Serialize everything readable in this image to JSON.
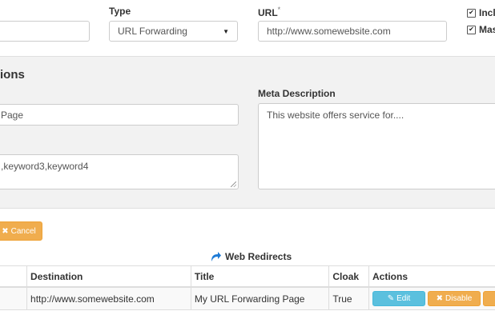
{
  "top_form": {
    "type_label": "Type",
    "type_value": "URL Forwarding",
    "url_label": "URL",
    "url_required_mark": "*",
    "url_value": "http://www.somewebsite.com",
    "include_label": "Inclu",
    "mask_label": "Mas"
  },
  "options": {
    "heading": "ions",
    "title_value": "Page",
    "keywords_value": ",keyword3,keyword4",
    "meta_label": "Meta Description",
    "meta_value": "This website offers service for...."
  },
  "cancel_label": "Cancel",
  "table": {
    "title": "Web Redirects",
    "headers": [
      "Destination",
      "Title",
      "Cloak",
      "Actions"
    ],
    "rows": [
      {
        "destination": "http://www.somewebsite.com",
        "title": "My URL Forwarding Page",
        "cloak": "True",
        "edit": "Edit",
        "disable": "Disable"
      }
    ]
  },
  "colors": {
    "panel_bg": "#f2f2f2",
    "warning": "#f0ad4e",
    "info": "#5bc0de",
    "link_blue": "#1e7bd6"
  }
}
